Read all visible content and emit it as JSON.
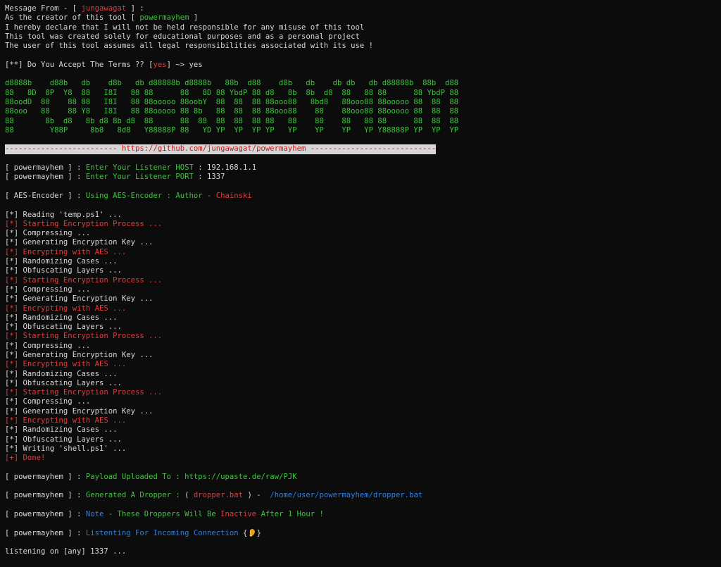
{
  "disclaimer": {
    "from_prefix": "Message From - [ ",
    "author": "jungawagat",
    "from_suffix": " ] :",
    "creator_prefix": "As the creator of this tool [ ",
    "tool": "powermayhem",
    "creator_suffix": " ]",
    "lines": [
      "I hereby declare that I will not be held responsible for any misuse of this tool",
      "This tool was created solely for educational purposes and as a personal project",
      "The user of this tool assumes all legal responsibilities associated with its use !"
    ]
  },
  "terms": {
    "prompt_prefix": "[**] Do You Accept The Terms ?? [",
    "option": "yes",
    "prompt_suffix": "] ~> ",
    "answer": "yes"
  },
  "banner": [
    "d8888b    d88b   db    d8b   db d88888b d8888b   88b  d88    d8b   db    db db   db d88888b  88b  d88",
    "88   8D  8P  Y8  88   I8I   88 88      88   8D 88 YbdP 88 d8   8b  8b  d8  88   88 88      88 YbdP 88",
    "88oodD  88    88 88   I8I   88 88ooooo 88oobY  88  88  88 88ooo88   8bd8   88ooo88 88ooooo 88  88  88",
    "88ooo   88    88 Y8   I8I   88 88ooooo 88 8b   88  88  88 88ooo88    88    88ooo88 88ooooo 88  88  88",
    "88       8b  d8   8b d8 8b d8  88      88  88  88  88  88 88   88    88    88   88 88      88  88  88",
    "88        Y88P     8b8   8d8   Y88888P 88   YD YP  YP  YP YP   YP    YP    YP   YP Y88888P YP  YP  YP"
  ],
  "separator": "------------------------- https://github.com/jungawagat/powermayhem ----------------------------",
  "listener": {
    "tag": "[ powermayhem ]",
    "host_label": "Enter Your Listener HOST",
    "host_value": "192.168.1.1",
    "port_label": "Enter Your Listener PORT",
    "port_value": "1337"
  },
  "encoder": {
    "tag": "[ AES-Encoder ]",
    "text": "Using AES-Encoder : Author - ",
    "author": "Chainski"
  },
  "log": [
    {
      "mark": "[*]",
      "text": "Reading 'temp.ps1' ...",
      "color": "w"
    },
    {
      "mark": "[*]",
      "text": "Starting Encryption Process ...",
      "color": "r"
    },
    {
      "mark": "[*]",
      "text": "Compressing ...",
      "color": "w"
    },
    {
      "mark": "[*]",
      "text": "Generating Encryption Key ...",
      "color": "w"
    },
    {
      "mark": "[*]",
      "text": "Encrypting with AES ...",
      "color": "r"
    },
    {
      "mark": "[*]",
      "text": "Randomizing Cases ...",
      "color": "w"
    },
    {
      "mark": "[*]",
      "text": "Obfuscating Layers ...",
      "color": "w"
    },
    {
      "mark": "[*]",
      "text": "Starting Encryption Process ...",
      "color": "r"
    },
    {
      "mark": "[*]",
      "text": "Compressing ...",
      "color": "w"
    },
    {
      "mark": "[*]",
      "text": "Generating Encryption Key ...",
      "color": "w"
    },
    {
      "mark": "[*]",
      "text": "Encrypting with AES ...",
      "color": "r"
    },
    {
      "mark": "[*]",
      "text": "Randomizing Cases ...",
      "color": "w"
    },
    {
      "mark": "[*]",
      "text": "Obfuscating Layers ...",
      "color": "w"
    },
    {
      "mark": "[*]",
      "text": "Starting Encryption Process ...",
      "color": "r"
    },
    {
      "mark": "[*]",
      "text": "Compressing ...",
      "color": "w"
    },
    {
      "mark": "[*]",
      "text": "Generating Encryption Key ...",
      "color": "w"
    },
    {
      "mark": "[*]",
      "text": "Encrypting with AES ...",
      "color": "r"
    },
    {
      "mark": "[*]",
      "text": "Randomizing Cases ...",
      "color": "w"
    },
    {
      "mark": "[*]",
      "text": "Obfuscating Layers ...",
      "color": "w"
    },
    {
      "mark": "[*]",
      "text": "Starting Encryption Process ...",
      "color": "r"
    },
    {
      "mark": "[*]",
      "text": "Compressing ...",
      "color": "w"
    },
    {
      "mark": "[*]",
      "text": "Generating Encryption Key ...",
      "color": "w"
    },
    {
      "mark": "[*]",
      "text": "Encrypting with AES ...",
      "color": "r"
    },
    {
      "mark": "[*]",
      "text": "Randomizing Cases ...",
      "color": "w"
    },
    {
      "mark": "[*]",
      "text": "Obfuscating Layers ...",
      "color": "w"
    },
    {
      "mark": "[*]",
      "text": "Writing 'shell.ps1' ...",
      "color": "w"
    },
    {
      "mark": "[+]",
      "text": "Done!",
      "color": "r"
    }
  ],
  "payload": {
    "tag": "[ powermayhem ]",
    "label": "Payload Uploaded To : https://upaste.de/raw/PJK"
  },
  "dropper": {
    "tag": "[ powermayhem ]",
    "label": "Generated A Dropper : ",
    "paren_open": "( ",
    "file": "dropper.bat",
    "paren_close": " ) -  ",
    "path": "/home/user/powermayhem/dropper.bat"
  },
  "note": {
    "tag": "[ powermayhem ]",
    "label": "Note",
    "text_a": " - These Droppers Will Be ",
    "inactive": "Inactive",
    "text_b": " After 1 Hour !"
  },
  "listening_msg": {
    "tag": "[ powermayhem ]",
    "label": "Listenting For Incoming Connection",
    "brace_open": " {",
    "emoji": "👂",
    "brace_close": "}"
  },
  "final_line": "listening on [any] 1337 ...",
  "colors": {
    "background": "#0c0c0c",
    "text": "#d8d8d8",
    "red": "#e23b3b",
    "green": "#3cc43c",
    "blue": "#2f7fe0",
    "separator_bg": "#d6d6d6"
  }
}
